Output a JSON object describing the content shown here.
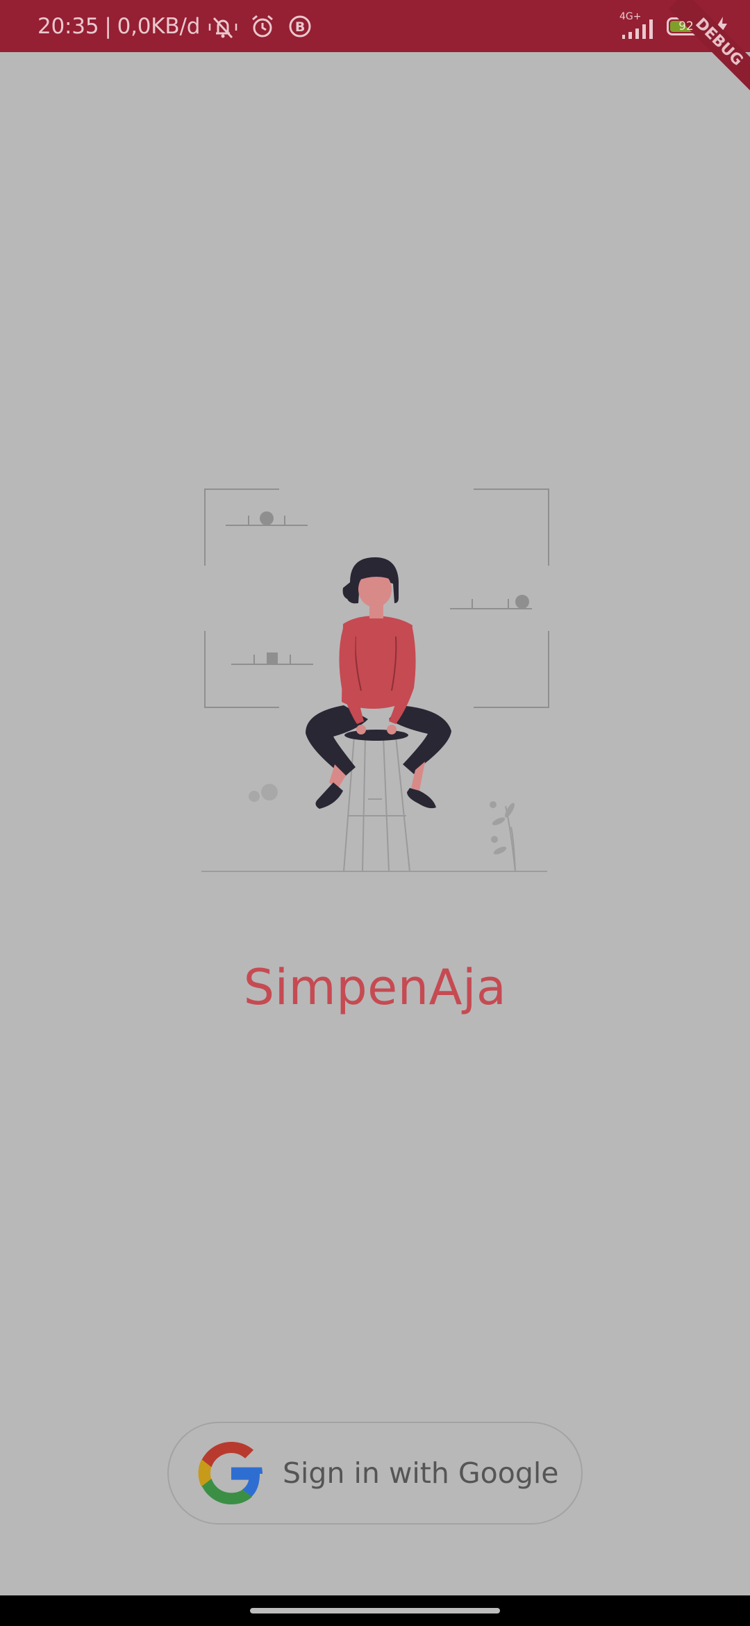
{
  "status_bar": {
    "time": "20:35",
    "separator": "|",
    "network_speed": "0,0KB/d",
    "network_type": "4G+",
    "battery_level": "92",
    "icons": [
      "silent-bell-icon",
      "alarm-icon",
      "b-badge-icon",
      "signal-icon",
      "battery-icon",
      "charging-bolt-icon"
    ]
  },
  "debug_banner": "DEBUG",
  "app": {
    "title": "SimpenAja"
  },
  "sign_in": {
    "label": "Sign in with Google",
    "icon": "google-logo-icon"
  },
  "colors": {
    "status_bar_bg": "#951f33",
    "background": "#b8b8b8",
    "title": "#c64a52",
    "figure_shirt": "#c64a52",
    "figure_pants": "#2a2734"
  }
}
